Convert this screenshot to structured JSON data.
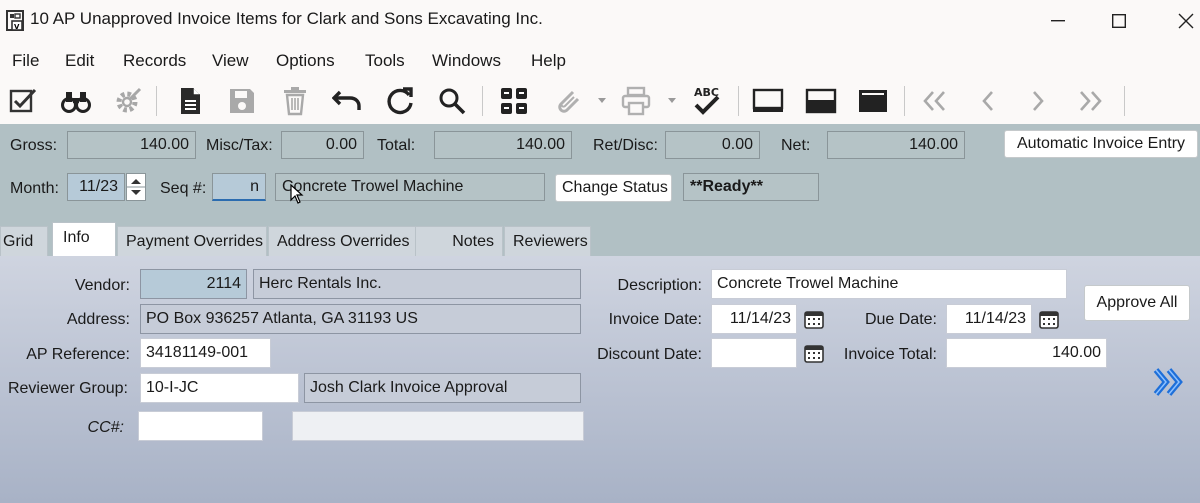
{
  "window": {
    "title": "10 AP Unapproved Invoice Items for Clark and Sons Excavating Inc."
  },
  "menu": [
    "File",
    "Edit",
    "Records",
    "View",
    "Options",
    "Tools",
    "Windows",
    "Help"
  ],
  "toolbar": {
    "icons": [
      "edit-check-icon",
      "binoculars-icon",
      "gear-icon",
      "new-document-icon",
      "save-icon",
      "delete-icon",
      "undo-icon",
      "refresh-icon",
      "search-icon",
      "grid-form-icon",
      "attach-icon",
      "print-icon",
      "spellcheck-icon",
      "layout-top-icon",
      "layout-middle-icon",
      "layout-bottom-icon",
      "first-record-icon",
      "previous-record-icon",
      "next-record-icon",
      "last-record-icon"
    ]
  },
  "header": {
    "gross_label": "Gross:",
    "gross_value": "140.00",
    "misc_label": "Misc/Tax:",
    "misc_value": "0.00",
    "total_label": "Total:",
    "total_value": "140.00",
    "retdisc_label": "Ret/Disc:",
    "retdisc_value": "0.00",
    "net_label": "Net:",
    "net_value": "140.00",
    "auto_entry_label": "Automatic Invoice Entry",
    "month_label": "Month:",
    "month_value": "11/23",
    "seq_label": "Seq #:",
    "seq_value": "n",
    "description_value": "Concrete Trowel Machine",
    "change_status_label": "Change Status",
    "status_value": "**Ready**"
  },
  "tabs": [
    "Grid",
    "Info",
    "Payment Overrides",
    "Address Overrides",
    "Notes",
    "Reviewers"
  ],
  "info": {
    "vendor_label": "Vendor:",
    "vendor_id": "2114",
    "vendor_name": "Herc Rentals Inc.",
    "address_label": "Address:",
    "address_value": "PO Box 936257  Atlanta, GA  31193  US",
    "ap_reference_label": "AP Reference:",
    "ap_reference_value": "34181149-001",
    "reviewer_group_label": "Reviewer Group:",
    "reviewer_group_value": "10-I-JC",
    "reviewer_group_desc": "Josh Clark Invoice Approval",
    "cc_label": "CC#:",
    "cc_value": "",
    "cc_desc": "",
    "description_label": "Description:",
    "description_value": "Concrete Trowel Machine",
    "invoice_date_label": "Invoice Date:",
    "invoice_date_value": "11/14/23",
    "due_date_label": "Due Date:",
    "due_date_value": "11/14/23",
    "discount_date_label": "Discount Date:",
    "discount_date_value": "",
    "invoice_total_label": "Invoice Total:",
    "invoice_total_value": "140.00",
    "approve_all_label": "Approve All"
  }
}
